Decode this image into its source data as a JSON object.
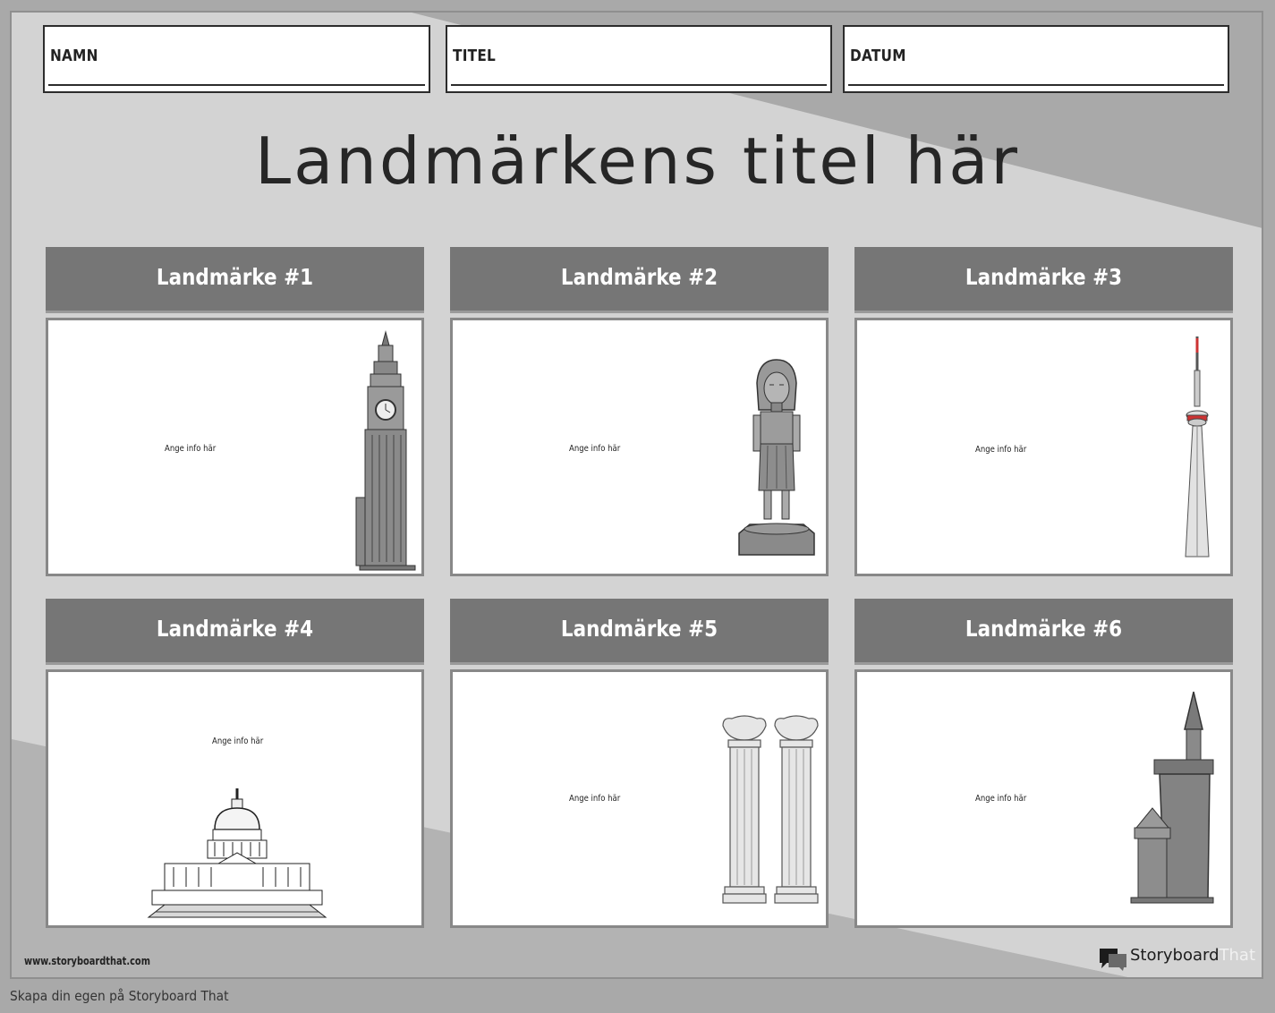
{
  "header_fields": [
    {
      "label": "NAMN"
    },
    {
      "label": "TITEL"
    },
    {
      "label": "DATUM"
    }
  ],
  "title": "Landmärkens titel här",
  "landmarks": [
    {
      "heading": "Landmärke #1",
      "info": "Ange info här",
      "image": "big-ben-clock-tower"
    },
    {
      "heading": "Landmärke #2",
      "info": "Ange info här",
      "image": "pharaoh-statue"
    },
    {
      "heading": "Landmärke #3",
      "info": "Ange info här",
      "image": "cn-tower"
    },
    {
      "heading": "Landmärke #4",
      "info": "Ange info här",
      "image": "us-capitol-building"
    },
    {
      "heading": "Landmärke #5",
      "info": "Ange info här",
      "image": "greek-columns"
    },
    {
      "heading": "Landmärke #6",
      "info": "Ange info här",
      "image": "castle-tower"
    }
  ],
  "website": "www.storyboardthat.com",
  "brand": {
    "part1": "Storyboard",
    "part2": "That"
  },
  "footer": "Skapa din egen på Storyboard That",
  "colors": {
    "background": "#a9a9a9",
    "panel_light": "#d4d4d4",
    "heading_bar": "#767676",
    "card_border": "#888888"
  }
}
